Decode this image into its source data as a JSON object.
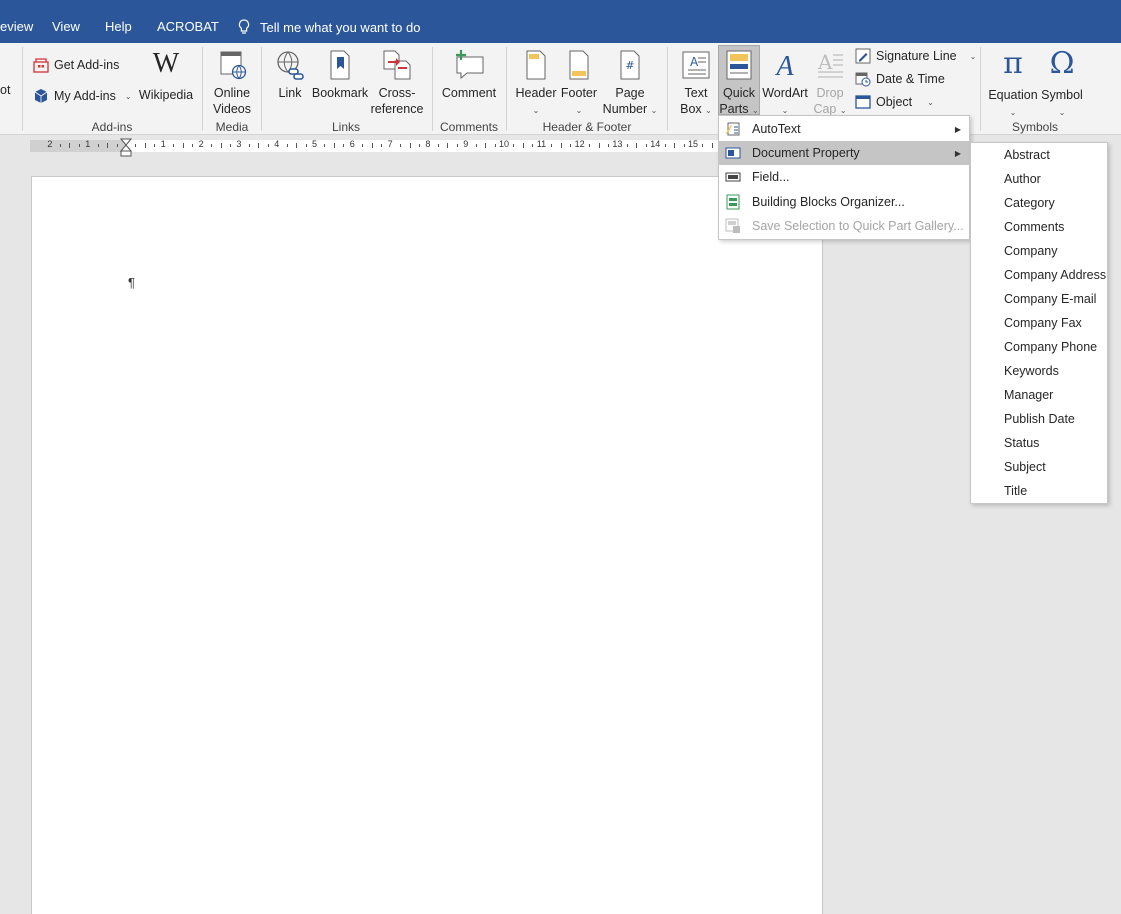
{
  "tabs": [
    "eview",
    "View",
    "Help",
    "ACROBAT"
  ],
  "tell_me": "Tell me what you want to do",
  "ribbon": {
    "cut_left": "ot",
    "addins": {
      "get": "Get Add-ins",
      "my": "My Add-ins",
      "wikipedia": "Wikipedia",
      "label": "Add-ins"
    },
    "media": {
      "online_videos_1": "Online",
      "online_videos_2": "Videos",
      "label": "Media"
    },
    "links": {
      "link": "Link",
      "bookmark": "Bookmark",
      "cross_1": "Cross-",
      "cross_2": "reference",
      "label": "Links"
    },
    "comments": {
      "comment": "Comment",
      "label": "Comments"
    },
    "header_footer": {
      "header": "Header",
      "footer": "Footer",
      "page_number_1": "Page",
      "page_number_2": "Number",
      "label": "Header & Footer"
    },
    "text": {
      "text_box_1": "Text",
      "text_box_2": "Box",
      "quick_parts_1": "Quick",
      "quick_parts_2": "Parts",
      "wordart": "WordArt",
      "drop_cap_1": "Drop",
      "drop_cap_2": "Cap",
      "signature_line": "Signature Line",
      "date_time": "Date & Time",
      "object": "Object"
    },
    "symbols": {
      "equation": "Equation",
      "symbol": "Symbol",
      "label": "Symbols"
    }
  },
  "ruler_numbers": [
    "2",
    "1",
    "1",
    "2",
    "3",
    "4",
    "5",
    "6",
    "7",
    "8",
    "9",
    "10",
    "11",
    "12",
    "13",
    "14",
    "15"
  ],
  "document": {
    "pilcrow": "¶"
  },
  "quick_parts_menu": [
    {
      "label": "AutoText",
      "submenu": true,
      "highlight": false,
      "disabled": false
    },
    {
      "label": "Document Property",
      "submenu": true,
      "highlight": true,
      "disabled": false
    },
    {
      "label": "Field...",
      "submenu": false,
      "highlight": false,
      "disabled": false
    },
    {
      "label": "Building Blocks Organizer...",
      "submenu": false,
      "highlight": false,
      "disabled": false
    },
    {
      "label": "Save Selection to Quick Part Gallery...",
      "submenu": false,
      "highlight": false,
      "disabled": true
    }
  ],
  "document_properties": [
    "Abstract",
    "Author",
    "Category",
    "Comments",
    "Company",
    "Company Address",
    "Company E-mail",
    "Company Fax",
    "Company Phone",
    "Keywords",
    "Manager",
    "Publish Date",
    "Status",
    "Subject",
    "Title"
  ],
  "colors": {
    "title_bar": "#2b579a",
    "ribbon": "#f3f3f3",
    "highlight": "#c5c5c5",
    "icon_blue": "#2b579a"
  }
}
